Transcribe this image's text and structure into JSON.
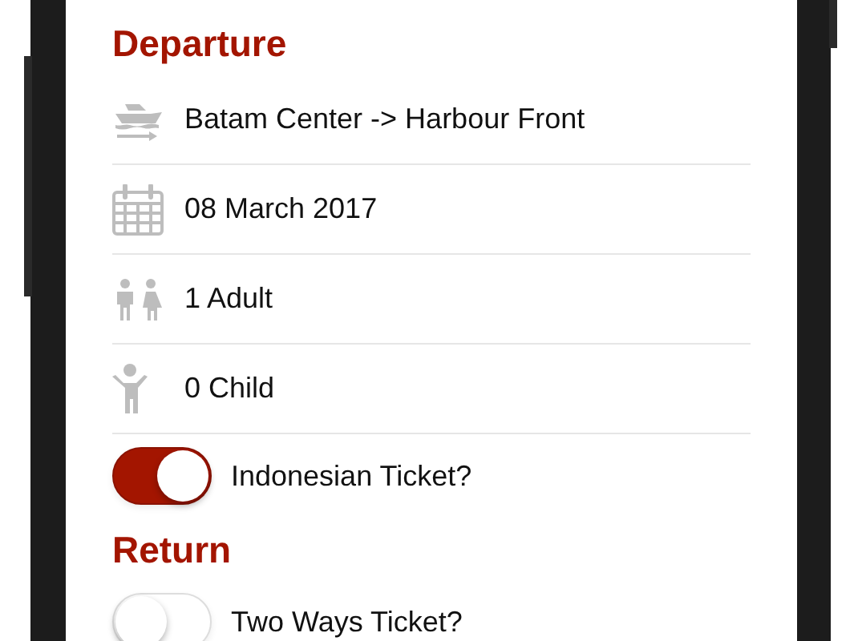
{
  "sections": [
    {
      "title": "Departure",
      "items": [
        {
          "kind": "info",
          "text": "Batam Center -> Harbour Front"
        },
        {
          "kind": "info",
          "text": "08 March 2017"
        },
        {
          "kind": "info",
          "text": "1 Adult"
        },
        {
          "kind": "info",
          "text": "0 Child"
        },
        {
          "kind": "toggle",
          "label": "Indonesian Ticket?",
          "on": true
        }
      ]
    },
    {
      "title": "Return",
      "items": [
        {
          "kind": "toggle",
          "label": "Two Ways Ticket?",
          "on": false
        }
      ]
    }
  ]
}
